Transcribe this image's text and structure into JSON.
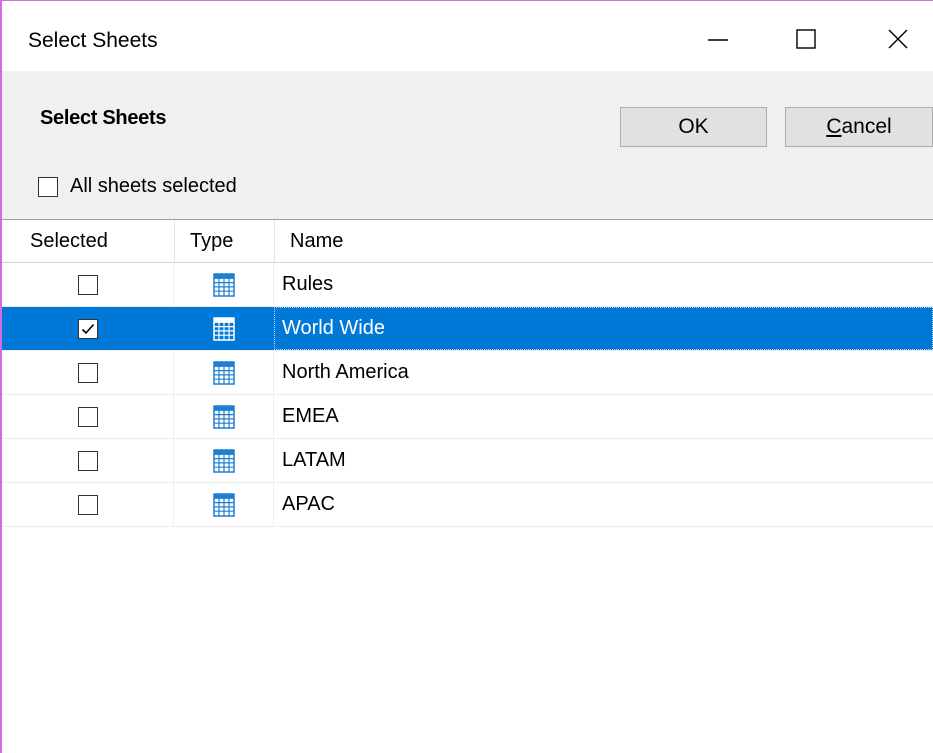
{
  "window": {
    "title": "Select Sheets",
    "controls": {
      "minimize": "minimize-icon",
      "maximize": "maximize-icon",
      "close": "close-icon"
    }
  },
  "panel": {
    "title": "Select Sheets",
    "ok_label": "OK",
    "cancel_label_accel": "C",
    "cancel_label_rest": "ancel",
    "all_sheets_label": "All sheets selected",
    "all_sheets_checked": false
  },
  "grid": {
    "columns": {
      "selected": "Selected",
      "type": "Type",
      "name": "Name"
    },
    "rows": [
      {
        "selected": false,
        "type_icon": "spreadsheet-icon",
        "name": "Rules"
      },
      {
        "selected": true,
        "type_icon": "spreadsheet-icon",
        "name": "World Wide",
        "highlighted": true
      },
      {
        "selected": false,
        "type_icon": "spreadsheet-icon",
        "name": "North America"
      },
      {
        "selected": false,
        "type_icon": "spreadsheet-icon",
        "name": "EMEA"
      },
      {
        "selected": false,
        "type_icon": "spreadsheet-icon",
        "name": "LATAM"
      },
      {
        "selected": false,
        "type_icon": "spreadsheet-icon",
        "name": "APAC"
      }
    ]
  },
  "colors": {
    "selection": "#0078d7",
    "sheet_icon": "#1e7fd0",
    "panel_bg": "#f0f0f0",
    "window_border": "#d36be0"
  }
}
